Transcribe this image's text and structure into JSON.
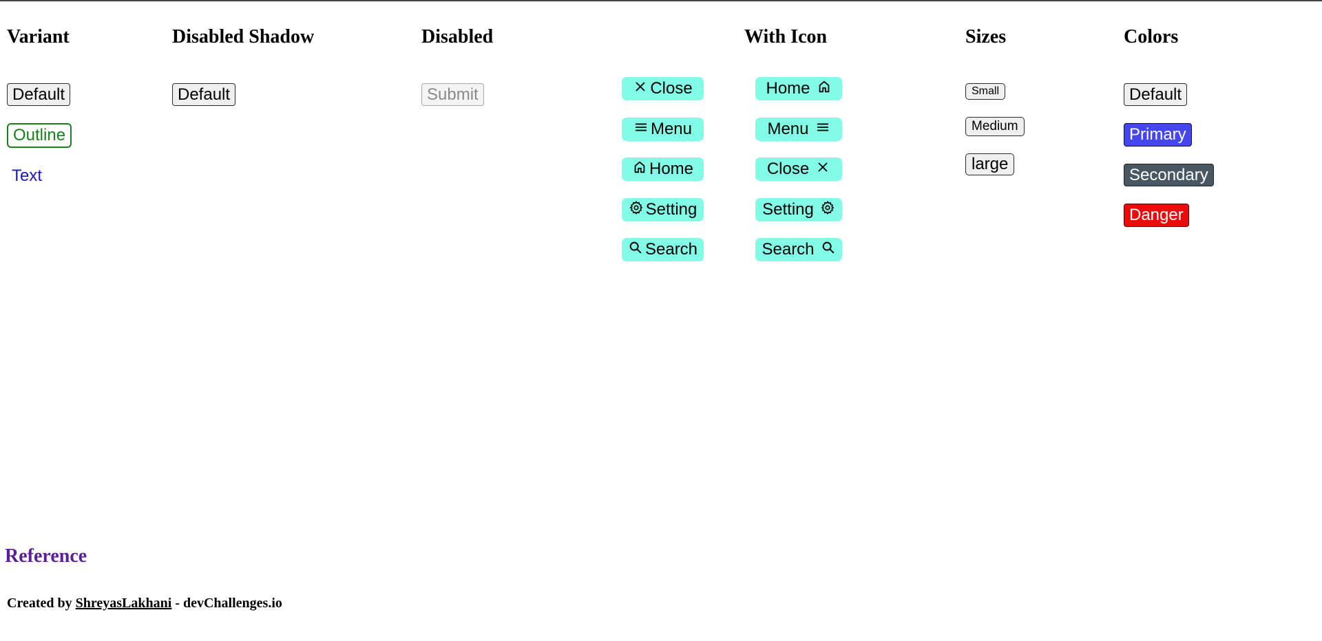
{
  "headings": {
    "variant": "Variant",
    "disabled_shadow": "Disabled Shadow",
    "disabled": "Disabled",
    "with_icon": "With Icon",
    "sizes": "Sizes",
    "colors": "Colors"
  },
  "variant": {
    "default": "Default",
    "outline": "Outline",
    "text": "Text"
  },
  "disabled_shadow": {
    "default": "Default"
  },
  "disabled": {
    "submit": "Submit"
  },
  "icon_start": [
    {
      "label": "Close",
      "icon": "close-icon"
    },
    {
      "label": "Menu",
      "icon": "menu-icon"
    },
    {
      "label": "Home",
      "icon": "home-icon"
    },
    {
      "label": "Setting",
      "icon": "gear-icon"
    },
    {
      "label": "Search",
      "icon": "search-icon"
    }
  ],
  "icon_end": [
    {
      "label": "Home",
      "icon": "home-icon"
    },
    {
      "label": "Menu",
      "icon": "menu-icon"
    },
    {
      "label": "Close",
      "icon": "close-icon"
    },
    {
      "label": "Setting",
      "icon": "gear-icon"
    },
    {
      "label": "Search",
      "icon": "search-icon"
    }
  ],
  "sizes": {
    "small": "Small",
    "medium": "Medium",
    "large": "large"
  },
  "colors": {
    "default": "Default",
    "primary": "Primary",
    "secondary": "Secondary",
    "danger": "Danger"
  },
  "palette": {
    "icon_button_bg": "#82fce7",
    "outline": "#16801a",
    "text_link": "#1818c8",
    "primary": "#4646f0",
    "secondary": "#495763",
    "danger": "#ec0b0b",
    "reference": "#5a1f9a"
  },
  "footer": {
    "reference": "Reference",
    "created_by": "Created by",
    "author": "ShreyasLakhani",
    "separator": "-",
    "site": "devChallenges.io"
  }
}
